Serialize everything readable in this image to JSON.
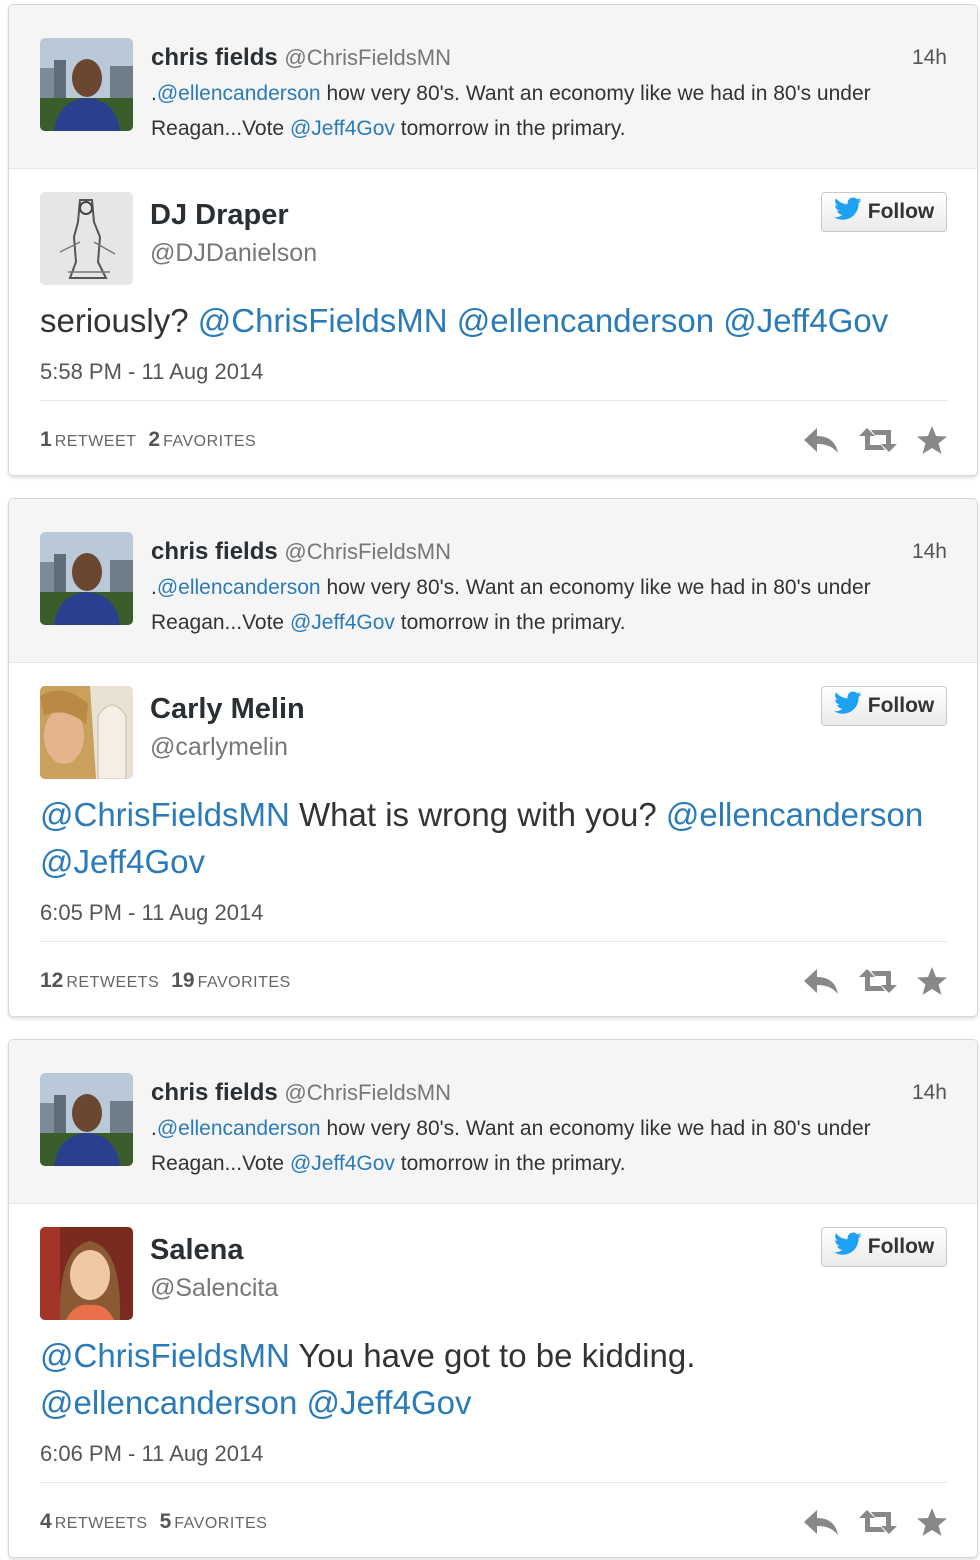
{
  "parent_tweet": {
    "name": "chris fields",
    "handle": "@ChrisFieldsMN",
    "time": "14h",
    "text_prefix": ".",
    "mention1": "@ellencanderson",
    "text_mid": " how very 80's. Want an economy like we had in 80's under Reagan...Vote ",
    "mention2": "@Jeff4Gov",
    "text_suffix": " tomorrow in the primary."
  },
  "follow_label": "Follow",
  "icons": {
    "follow": "twitter-bird-icon",
    "reply": "reply-icon",
    "retweet": "retweet-icon",
    "favorite": "star-icon"
  },
  "colors": {
    "link": "#2b7bb9",
    "twitter_blue": "#1da1f2",
    "action_gray": "#888888"
  },
  "replies": [
    {
      "name": "DJ Draper",
      "handle": "@DJDanielson",
      "text_pre": "seriously? ",
      "mentions_a": "",
      "text_mid": "",
      "mentions_b": "@ChrisFieldsMN @ellencanderson @Jeff4Gov",
      "date": "5:58 PM - 11 Aug 2014",
      "retweet_count": "1",
      "retweet_label": "Retweet",
      "favorite_count": "2",
      "favorite_label": "Favorites"
    },
    {
      "name": "Carly Melin",
      "handle": "@carlymelin",
      "text_pre": "",
      "mentions_a": "@ChrisFieldsMN",
      "text_mid": " What is wrong with you? ",
      "mentions_b": "@ellencanderson @Jeff4Gov",
      "date": "6:05 PM - 11 Aug 2014",
      "retweet_count": "12",
      "retweet_label": "Retweets",
      "favorite_count": "19",
      "favorite_label": "Favorites"
    },
    {
      "name": "Salena",
      "handle": "@Salencita",
      "text_pre": "",
      "mentions_a": "@ChrisFieldsMN",
      "text_mid": " You have got to be kidding. ",
      "mentions_b": "@ellencanderson @Jeff4Gov",
      "date": "6:06 PM - 11 Aug 2014",
      "retweet_count": "4",
      "retweet_label": "Retweets",
      "favorite_count": "5",
      "favorite_label": "Favorites"
    }
  ]
}
